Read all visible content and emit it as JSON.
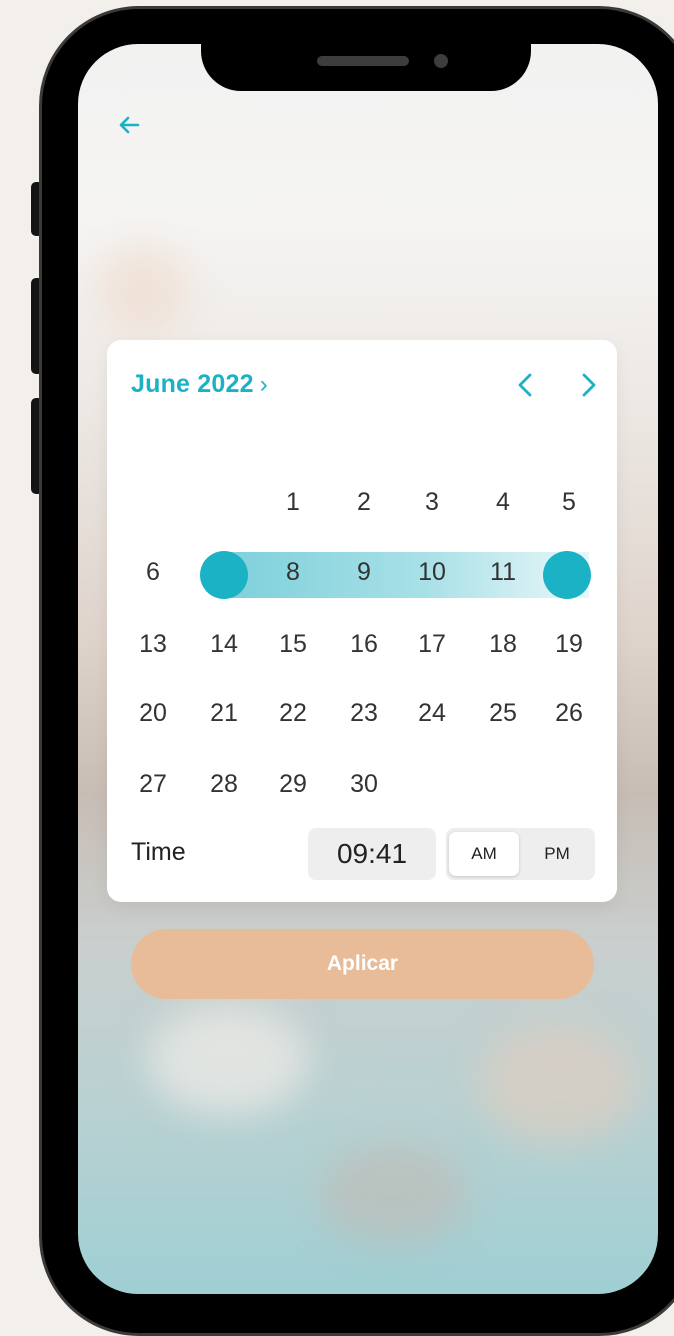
{
  "calendar": {
    "month_label": "June 2022",
    "month_chevron": "›",
    "prev_icon": "chevron-left-icon",
    "next_icon": "chevron-right-icon",
    "weeks": [
      [
        "",
        "",
        "1",
        "2",
        "3",
        "4",
        "5"
      ],
      [
        "6",
        "",
        "8",
        "9",
        "10",
        "11",
        ""
      ],
      [
        "13",
        "14",
        "15",
        "16",
        "17",
        "18",
        "19"
      ],
      [
        "20",
        "21",
        "22",
        "23",
        "24",
        "25",
        "26"
      ],
      [
        "27",
        "28",
        "29",
        "30",
        "",
        "",
        ""
      ]
    ],
    "range_start_selected": true,
    "range_end_selected": true
  },
  "time": {
    "label": "Time",
    "value": "09:41",
    "am_label": "AM",
    "pm_label": "PM",
    "selected_period": "AM"
  },
  "apply_button": {
    "label": "Aplicar"
  },
  "colors": {
    "accent": "#1cb2c6",
    "button": "#e8bc98"
  },
  "icons": {
    "back": "arrow-left-icon"
  }
}
